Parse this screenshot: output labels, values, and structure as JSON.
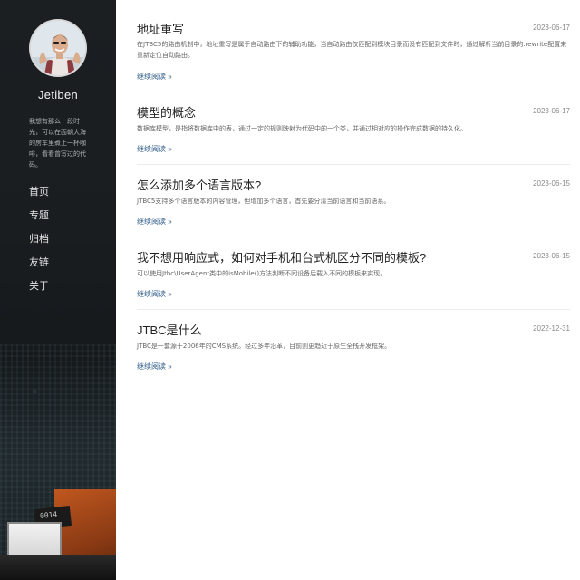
{
  "sidebar": {
    "author": "Jetiben",
    "bio": "我想有那么一段时光，可以在面朝大海的房车里煮上一杯咖啡，看看曾写过的代码。",
    "nav": [
      {
        "label": "首页"
      },
      {
        "label": "专题"
      },
      {
        "label": "归档"
      },
      {
        "label": "友链"
      },
      {
        "label": "关于"
      }
    ],
    "board_label": "0014"
  },
  "articles": [
    {
      "title": "地址重写",
      "date": "2023-06-17",
      "excerpt": "在JTBC5的路由机制中，地址重写是属于自动路由下的辅助功能，当自动路由仅匹配到模块目录而没有匹配到文件时，通过解析当前目录的.rewrite配置来重新定位自动路由。",
      "more": "继续阅读 »"
    },
    {
      "title": "模型的概念",
      "date": "2023-06-17",
      "excerpt": "数据库模型，是指将数据库中的表，通过一定的规则映射为代码中的一个类，并通过相对应的操作完成数据的持久化。",
      "more": "继续阅读 »"
    },
    {
      "title": "怎么添加多个语言版本?",
      "date": "2023-06-15",
      "excerpt": "JTBC5支持多个语言版本的内容管理，但增加多个语言，首先要分清当前语言和当前语系。",
      "more": "继续阅读 »"
    },
    {
      "title": "我不想用响应式，如何对手机和台式机区分不同的模板?",
      "date": "2023-06-15",
      "excerpt": "可以使用Jtbc\\UserAgent类中的isMobile()方法判断不同设备后载入不同的模板来实现。",
      "more": "继续阅读 »"
    },
    {
      "title": "JTBC是什么",
      "date": "2022-12-31",
      "excerpt": "JTBC是一套源于2006年的CMS系统。经过多年沿革，目前则更趋近于原生全栈开发框架。",
      "more": "继续阅读 »"
    }
  ]
}
